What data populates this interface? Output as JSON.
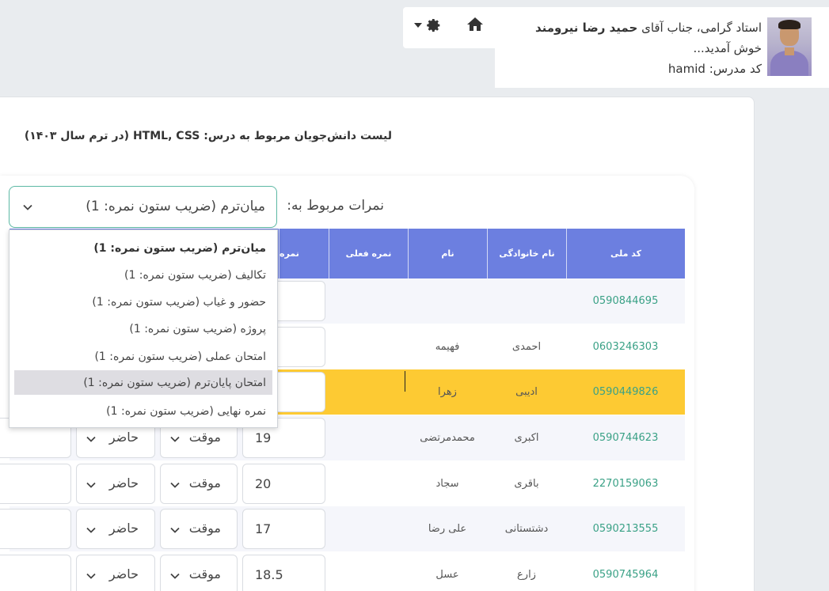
{
  "header": {
    "greeting_prefix": "استاد گرامی، جناب آقای",
    "teacher_name": "حمید رضا نیرومند",
    "welcome": "خوش آمدید...",
    "code_label": "کد مدرس:",
    "code_value": "hamid"
  },
  "list_title": "لیست دانش‌جویان مربوط به درس: HTML, CSS (در ترم سال ۱۴۰۳)",
  "grades_label": "نمرات مربوط به:",
  "grade_select": {
    "selected": "میان‌ترم (ضریب ستون نمره: 1)",
    "options": [
      "میان‌ترم (ضریب ستون نمره: 1)",
      "تکالیف (ضریب ستون نمره: 1)",
      "حضور و غیاب (ضریب ستون نمره: 1)",
      "پروژه (ضریب ستون نمره: 1)",
      "امتحان عملی (ضریب ستون نمره: 1)",
      "امتحان پایان‌ترم (ضریب ستون نمره: 1)",
      "نمره نهایی (ضریب ستون نمره: 1)"
    ]
  },
  "table": {
    "headers": [
      "کد ملی",
      "نام خانوادگی",
      "نام",
      "نمره فعلی",
      "نمره"
    ],
    "rows": [
      {
        "national_id": "0590844695",
        "last_name": "",
        "first_name": "",
        "score": "",
        "status": "",
        "presence": ""
      },
      {
        "national_id": "0603246303",
        "last_name": "احمدی",
        "first_name": "فهیمه",
        "score": "",
        "status": "",
        "presence": ""
      },
      {
        "national_id": "0590449826",
        "last_name": "ادیبی",
        "first_name": "زهرا",
        "score": "",
        "status": "",
        "presence": ""
      },
      {
        "national_id": "0590744623",
        "last_name": "اکبری",
        "first_name": "محمدمرتضی",
        "score": "19",
        "status": "موقت",
        "presence": "حاضر"
      },
      {
        "national_id": "2270159063",
        "last_name": "باقری",
        "first_name": "سجاد",
        "score": "20",
        "status": "موقت",
        "presence": "حاضر"
      },
      {
        "national_id": "0590213555",
        "last_name": "دشتستانی",
        "first_name": "علی رضا",
        "score": "17",
        "status": "موقت",
        "presence": "حاضر"
      },
      {
        "national_id": "0590745964",
        "last_name": "زارع",
        "first_name": "عسل",
        "score": "18.5",
        "status": "موقت",
        "presence": "حاضر"
      }
    ]
  },
  "icons": {
    "home": "home-icon",
    "settings": "gear-icon",
    "menu_caret": "caret-down-icon"
  },
  "colors": {
    "table_header": "#6c7fe0",
    "highlight_row": "#fdca33",
    "national_id_text": "#3aa186",
    "select_border": "#5cb8a4"
  }
}
